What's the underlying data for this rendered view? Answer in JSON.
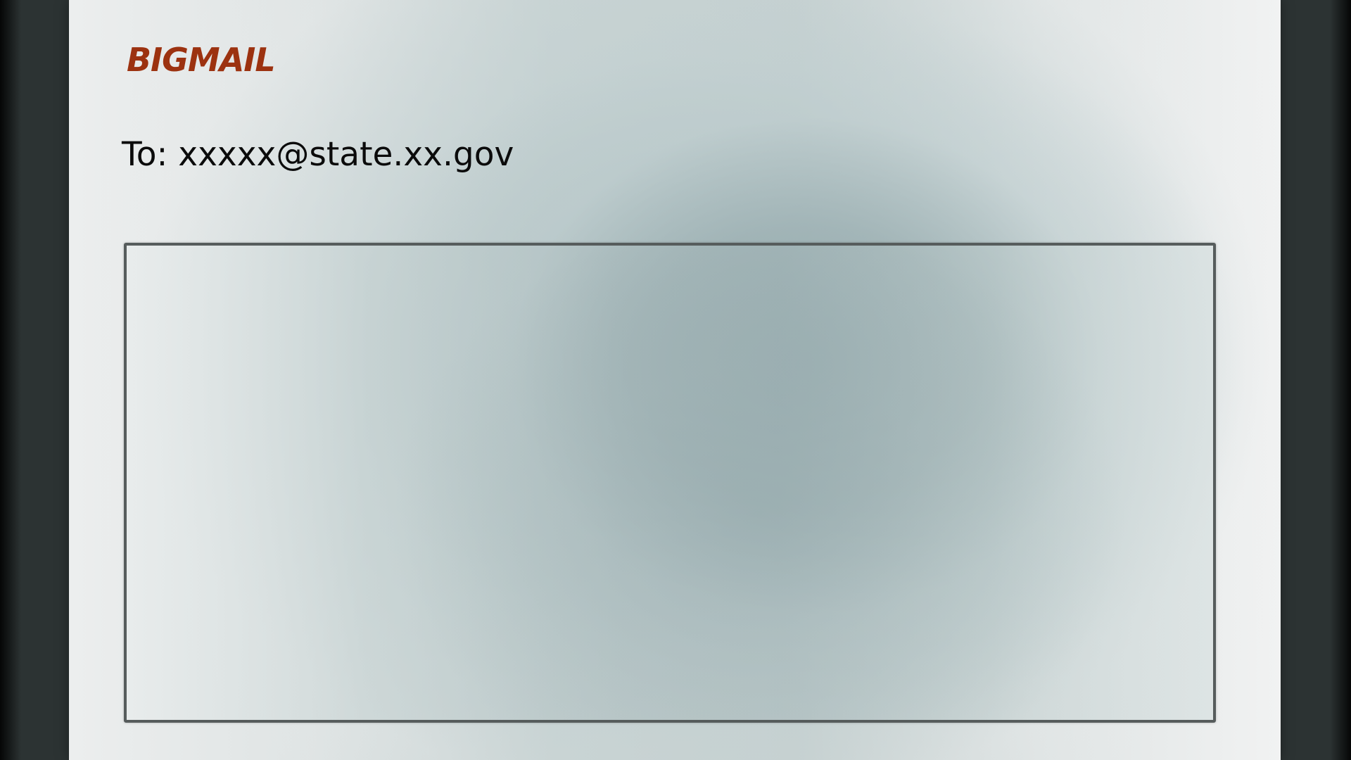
{
  "app": {
    "brand": "BIGMAIL"
  },
  "compose": {
    "to_label": "To:",
    "to_value": "xxxxx@state.xx.gov",
    "body_value": ""
  },
  "colors": {
    "brand": "#9c3210",
    "outer_frame": "#2c3333",
    "text": "#0b0b0b",
    "border": "#565c5c"
  }
}
